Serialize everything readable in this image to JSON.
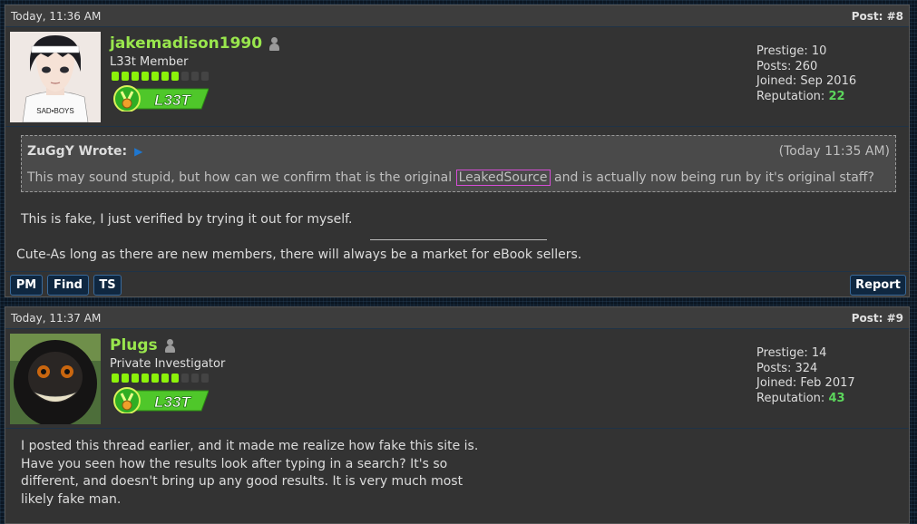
{
  "posts": [
    {
      "time": "Today, 11:36 AM",
      "number": "Post: #8",
      "author": {
        "username": "jakemadison1990",
        "rank_title": "L33t Member",
        "badge_text": "L33T",
        "stars_filled": 7,
        "stars_total": 10,
        "stats": {
          "prestige": "Prestige: 10",
          "posts": "Posts: 260",
          "joined": "Joined: Sep 2016",
          "reputation_label": "Reputation:",
          "reputation_value": "22"
        },
        "avatar_shirt_text": "SAD•BOYS"
      },
      "quote": {
        "author": "ZuGgY Wrote:",
        "arrow_icon": "play-arrow-icon",
        "time": "(Today 11:35 AM)",
        "text_before": "This may sound stupid, but how can we confirm that is the original ",
        "highlight": "LeakedSource",
        "text_after": " and is actually now being run by it's original staff?"
      },
      "body": "This is fake, I just verified by trying it out for myself.",
      "signature": "Cute-As long as there are new members, there will always be a market for eBook sellers.",
      "buttons": {
        "pm": "PM",
        "find": "Find",
        "ts": "TS",
        "report": "Report"
      }
    },
    {
      "time": "Today, 11:37 AM",
      "number": "Post: #9",
      "author": {
        "username": "Plugs",
        "rank_title": "Private Investigator",
        "badge_text": "L33T",
        "stars_filled": 7,
        "stars_total": 10,
        "stats": {
          "prestige": "Prestige: 14",
          "posts": "Posts: 324",
          "joined": "Joined: Feb 2017",
          "reputation_label": "Reputation:",
          "reputation_value": "43"
        }
      },
      "body_lines": [
        "I posted this thread earlier, and it made me realize how fake this site is.",
        "Have you seen how the results look after typing in a search? It's so",
        "different, and doesn't bring up any good results. It is very much most",
        "likely fake man."
      ]
    }
  ],
  "colors": {
    "username": "#99e64d",
    "reputation": "#5cd65c",
    "star_on": "#8cf20a",
    "button_bg": "#0f2740",
    "highlight_border": "#d64dd6"
  }
}
